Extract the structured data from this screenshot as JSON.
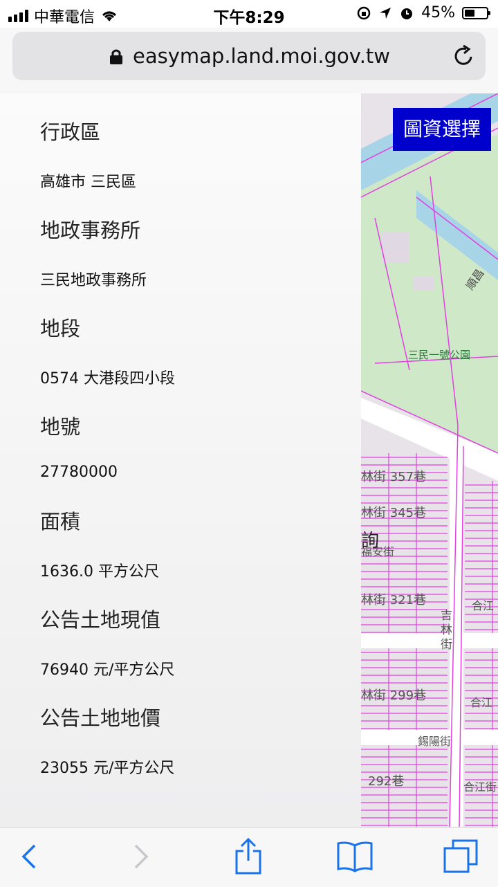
{
  "status_bar": {
    "carrier": "中華電信",
    "time": "下午8:29",
    "battery": "45%",
    "battery_level": 0.45
  },
  "browser": {
    "url": "easymap.land.moi.gov.tw"
  },
  "map": {
    "layer_button_label": "圖資選擇",
    "labels": {
      "street_357": "林街 357巷",
      "street_345": "林街 345巷",
      "fuan": "福安街",
      "street_321": "林街 321巷",
      "jilin": "吉林街",
      "heji_1": "合江",
      "street_299": "林街 299巷",
      "heji_2": "合江",
      "xiyang": "錫陽街",
      "street_292": "292巷",
      "heji_3": "合江街",
      "park": "三民一號公園",
      "shun": "順昌",
      "marker": "詢"
    }
  },
  "panel": {
    "items": [
      {
        "label": "行政區",
        "value": "高雄市 三民區"
      },
      {
        "label": "地政事務所",
        "value": "三民地政事務所"
      },
      {
        "label": "地段",
        "value": "0574 大港段四小段"
      },
      {
        "label": "地號",
        "value": "27780000"
      },
      {
        "label": "面積",
        "value": "1636.0 平方公尺"
      },
      {
        "label": "公告土地現值",
        "value": "76940 元/平方公尺"
      },
      {
        "label": "公告土地地價",
        "value": "23055 元/平方公尺"
      }
    ]
  },
  "colors": {
    "layer_button": "#0000cc",
    "parcel_line": "#e040e0",
    "river": "#a8d4e8",
    "park": "#cfe8c8",
    "toolbar_icon": "#1a73e8"
  }
}
